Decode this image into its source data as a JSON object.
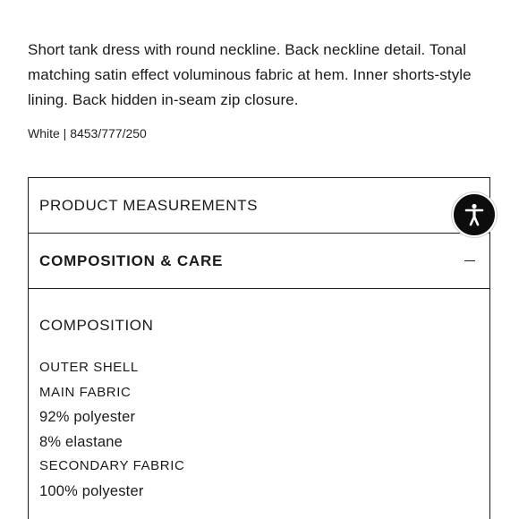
{
  "product": {
    "description": "Short tank dress with round neckline. Back neckline detail. Tonal matching satin effect voluminous fabric at hem. Inner shorts-style lining. Back hidden in-seam zip closure.",
    "color_ref": "White | 8453/777/250"
  },
  "accordion": {
    "measurements_label": "PRODUCT MEASUREMENTS",
    "composition_label": "COMPOSITION & CARE",
    "composition_expanded": true,
    "composition_section": {
      "title": "COMPOSITION",
      "lines": [
        "OUTER SHELL",
        "MAIN FABRIC",
        "92% polyester",
        "8% elastane",
        "SECONDARY FABRIC",
        "100% polyester"
      ]
    }
  },
  "icons": {
    "accessibility": "accessibility-icon",
    "collapse": "minus-icon"
  },
  "colors": {
    "text": "#1a1a1a",
    "border": "#1a1a1a",
    "accessibility_button_bg": "#0d0d0d"
  }
}
